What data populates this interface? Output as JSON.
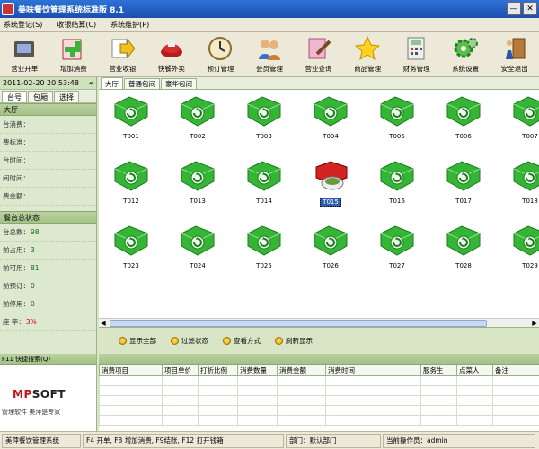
{
  "window": {
    "title": "美味餐饮管理系统标准版 8.1",
    "minimize_label": "—",
    "close_label": "✕"
  },
  "menu": [
    "系统登记(S)",
    "收银结算(C)",
    "系统维护(P)"
  ],
  "toolbar": [
    {
      "label": "营业开单",
      "icon": "open-order-icon"
    },
    {
      "label": "增加消费",
      "icon": "add-consumption-icon"
    },
    {
      "label": "营业收银",
      "icon": "checkout-icon"
    },
    {
      "label": "快餐外卖",
      "icon": "takeout-icon"
    },
    {
      "label": "预订管理",
      "icon": "reservation-clock-icon"
    },
    {
      "label": "会员管理",
      "icon": "members-icon"
    },
    {
      "label": "营业查询",
      "icon": "query-icon"
    },
    {
      "label": "商品管理",
      "icon": "goods-star-icon"
    },
    {
      "label": "财务管理",
      "icon": "finance-icon"
    },
    {
      "label": "系统设置",
      "icon": "settings-gear-icon"
    },
    {
      "label": "安全退出",
      "icon": "exit-door-icon"
    }
  ],
  "left": {
    "datetime": "2011-02-20 20:53:48",
    "tabs": [
      "台号",
      "包厢",
      "选择"
    ],
    "hall": {
      "title": "大厅",
      "rows": [
        "台消费：",
        "费标准：",
        "台时间：",
        "间时间：",
        "费金额："
      ]
    },
    "status": {
      "title": "餐台总状态",
      "rows": [
        {
          "label": "台总数：",
          "value": "98"
        },
        {
          "label": "前占用：",
          "value": "3"
        },
        {
          "label": "前可用：",
          "value": "81"
        },
        {
          "label": "前预订：",
          "value": "0"
        },
        {
          "label": "前停用：",
          "value": "0"
        },
        {
          "label": "座 率：",
          "value": "3%"
        }
      ]
    }
  },
  "main": {
    "tabs": [
      "大厅",
      "普通包间",
      "豪华包间"
    ],
    "tables": [
      {
        "id": "T001",
        "state": "free"
      },
      {
        "id": "T002",
        "state": "free"
      },
      {
        "id": "T003",
        "state": "free"
      },
      {
        "id": "T004",
        "state": "free"
      },
      {
        "id": "T005",
        "state": "free"
      },
      {
        "id": "T006",
        "state": "free"
      },
      {
        "id": "T007",
        "state": "free"
      },
      {
        "id": "T012",
        "state": "free"
      },
      {
        "id": "T013",
        "state": "free"
      },
      {
        "id": "T014",
        "state": "free"
      },
      {
        "id": "T015",
        "state": "occupied"
      },
      {
        "id": "T016",
        "state": "free"
      },
      {
        "id": "T017",
        "state": "free"
      },
      {
        "id": "T018",
        "state": "free"
      },
      {
        "id": "T023",
        "state": "free"
      },
      {
        "id": "T024",
        "state": "free"
      },
      {
        "id": "T025",
        "state": "free"
      },
      {
        "id": "T026",
        "state": "free"
      },
      {
        "id": "T027",
        "state": "free"
      },
      {
        "id": "T028",
        "state": "free"
      },
      {
        "id": "T029",
        "state": "free"
      }
    ],
    "selected_table": "T015",
    "buttons": [
      "显示全部",
      "过滤状态",
      "查看方式",
      "刷新显示"
    ]
  },
  "bottom": {
    "left_header": "F11 快捷搜索(Q)",
    "logo": {
      "part1": "MP",
      "part2": "SOFT"
    },
    "slogan": "管理软件 美萍是专家",
    "columns": [
      "消费项目",
      "项目单价",
      "打折比例",
      "消费数量",
      "消费金额",
      "消费时间",
      "服务生",
      "点菜人",
      "备注"
    ]
  },
  "statusbar": [
    "美萍餐饮管理系统",
    "F4 开单, F8 增加消费, F9结账, F12 打开钱箱",
    "部门：默认部门",
    "当前操作员：admin"
  ],
  "colors": {
    "free_table": "#35b535",
    "occupied_table": "#d42323",
    "accent_value": "#1a6b1a"
  }
}
